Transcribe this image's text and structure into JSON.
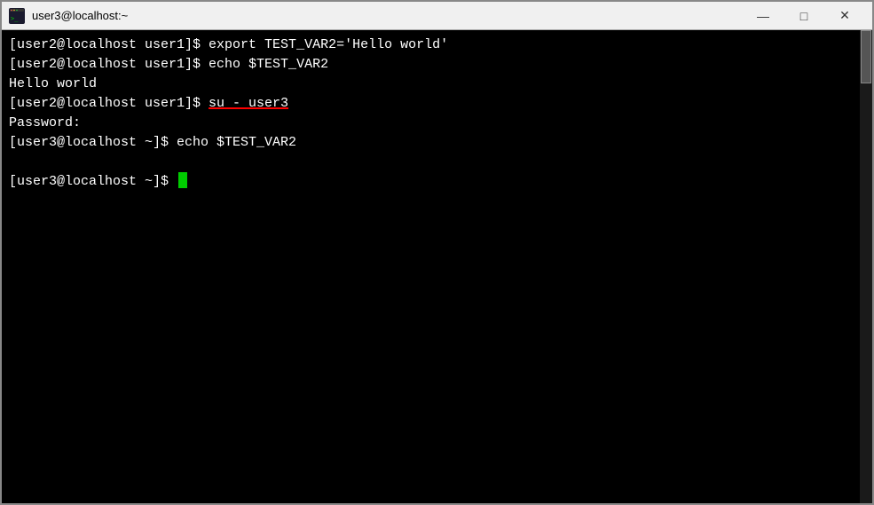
{
  "window": {
    "title": "user3@localhost:~",
    "icon_label": "terminal-icon"
  },
  "title_buttons": {
    "minimize_label": "—",
    "maximize_label": "□",
    "close_label": "✕"
  },
  "terminal": {
    "lines": [
      {
        "id": "line1",
        "prompt": "[user2@localhost user1]$ ",
        "command": "export TEST_VAR2='Hello world'"
      },
      {
        "id": "line2",
        "prompt": "[user2@localhost user1]$ ",
        "command": "echo $TEST_VAR2"
      },
      {
        "id": "line3",
        "output": "Hello world"
      },
      {
        "id": "line4",
        "prompt": "[user2@localhost user1]$ ",
        "command": "su - user3",
        "underline_cmd": true
      },
      {
        "id": "line5",
        "output": "Password:"
      },
      {
        "id": "line6",
        "prompt": "[user3@localhost ~]$ ",
        "command": "echo $TEST_VAR2"
      },
      {
        "id": "line7",
        "output": ""
      },
      {
        "id": "line8",
        "prompt": "[user3@localhost ~]$ ",
        "cursor": true
      }
    ]
  }
}
